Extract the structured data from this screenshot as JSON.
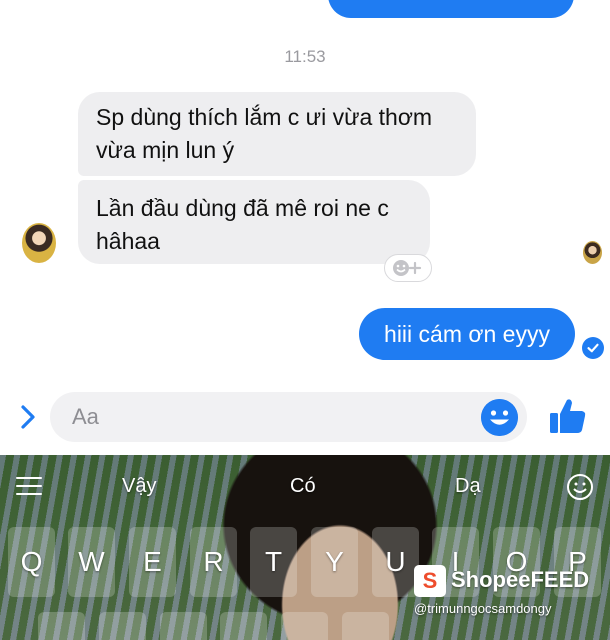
{
  "chat": {
    "timestamp": "11:53",
    "incoming": [
      {
        "text": "Sp dùng thích lắm c ưi vừa thơm vừa mịn lun ý"
      },
      {
        "text": "Lần đầu dùng đã mê roi ne c hâhaa"
      }
    ],
    "outgoing": [
      {
        "text": "hiii cám ơn eyyy"
      }
    ]
  },
  "composer": {
    "placeholder": "Aa"
  },
  "keyboard": {
    "suggestions": [
      "Vậy",
      "Có",
      "Dạ"
    ],
    "keys": [
      "Q",
      "W",
      "E",
      "R",
      "T",
      "Y",
      "U",
      "I",
      "O",
      "P"
    ]
  },
  "watermark": {
    "logo_letter": "S",
    "brand": "ShopeeFEED",
    "handle": "@trimunngocsamdongy"
  },
  "colors": {
    "accent": "#1f7cf2",
    "incoming_bubble": "#eeeef0",
    "timestamp": "#9a9a9f"
  },
  "icons": {
    "composer_expand": "chevron-right-icon",
    "composer_emoji": "smiley-icon",
    "composer_like": "thumbs-up-icon",
    "reaction": "add-reaction-icon",
    "seen": "check-circle-icon",
    "keyboard_menu": "menu-icon",
    "keyboard_emoji": "emoji-icon"
  }
}
